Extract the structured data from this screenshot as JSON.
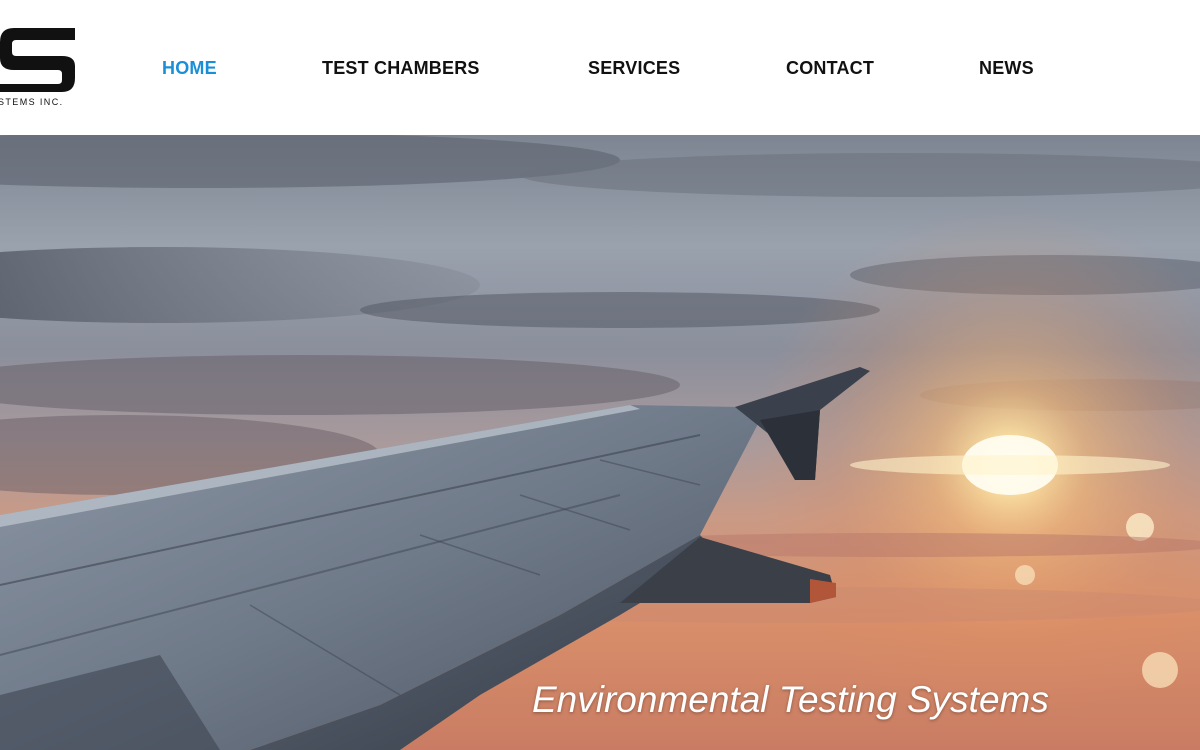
{
  "logo": {
    "tagline": "STEMS INC.",
    "icon": "company-logo-s"
  },
  "nav": {
    "items": [
      {
        "label": "HOME",
        "active": true
      },
      {
        "label": "TEST CHAMBERS",
        "active": false
      },
      {
        "label": "SERVICES",
        "active": false
      },
      {
        "label": "CONTACT",
        "active": false
      },
      {
        "label": "NEWS",
        "active": false
      }
    ],
    "active_color": "#1a8fd8",
    "text_color": "#111111"
  },
  "hero": {
    "caption": "Environmental Testing Systems",
    "image": "airplane-wing-sunset-photo"
  }
}
